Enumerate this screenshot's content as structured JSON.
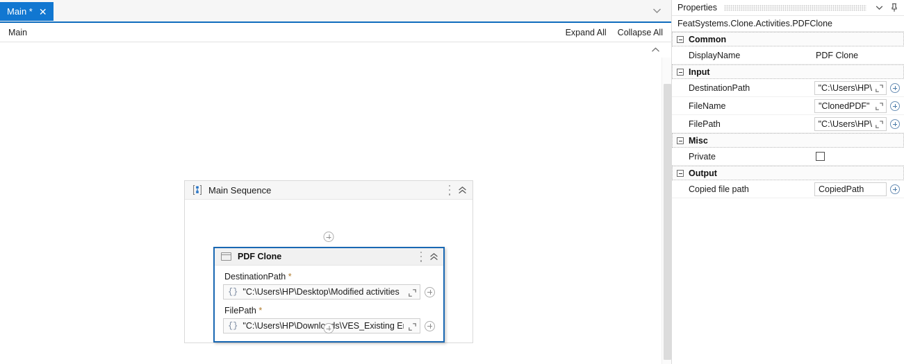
{
  "tabstrip": {
    "tab_label": "Main *",
    "close_icon": "close-icon",
    "dropdown_icon": "chevron-down-icon"
  },
  "breadcrumb": {
    "crumb": "Main",
    "expand_all": "Expand All",
    "collapse_all": "Collapse All"
  },
  "canvas": {
    "sequence": {
      "title": "Main Sequence",
      "icon": "sequence-icon",
      "menu_icon": "kebab-menu-icon",
      "collapse_icon": "double-chevron-up-icon",
      "add_above_icon": "plus-circle-icon",
      "add_below_icon": "plus-circle-icon"
    },
    "activity": {
      "title": "PDF Clone",
      "icon": "window-rect-icon",
      "menu_icon": "kebab-menu-icon",
      "collapse_icon": "double-chevron-up-icon",
      "fields": [
        {
          "label": "DestinationPath",
          "required_marker": "*",
          "prefix": "{}",
          "value": "\"C:\\Users\\HP\\Desktop\\Modified activities",
          "expand_icon": "open-expression-editor-icon",
          "plus_icon": "plus-circle-icon"
        },
        {
          "label": "FilePath",
          "required_marker": "*",
          "prefix": "{}",
          "value": "\"C:\\Users\\HP\\Downloads\\VES_Existing En",
          "expand_icon": "open-expression-editor-icon",
          "plus_icon": "plus-circle-icon"
        }
      ]
    }
  },
  "properties": {
    "panel_title": "Properties",
    "collapse_icon": "chevron-down-icon",
    "pin_icon": "pin-icon",
    "type_name": "FeatSystems.Clone.Activities.PDFClone",
    "groups": [
      {
        "name": "Common",
        "rows": [
          {
            "name": "DisplayName",
            "value": "PDF Clone",
            "kind": "text"
          }
        ]
      },
      {
        "name": "Input",
        "rows": [
          {
            "name": "DestinationPath",
            "value": "\"C:\\Users\\HP\\",
            "kind": "box",
            "expand_icon": "open-expression-editor-icon",
            "plus_icon": "plus-circle-icon"
          },
          {
            "name": "FileName",
            "value": "\"ClonedPDF\"",
            "kind": "box",
            "expand_icon": "open-expression-editor-icon",
            "plus_icon": "plus-circle-icon"
          },
          {
            "name": "FilePath",
            "value": "\"C:\\Users\\HP\\",
            "kind": "box",
            "expand_icon": "open-expression-editor-icon",
            "plus_icon": "plus-circle-icon"
          }
        ]
      },
      {
        "name": "Misc",
        "rows": [
          {
            "name": "Private",
            "value": "",
            "kind": "checkbox",
            "checked": false
          }
        ]
      },
      {
        "name": "Output",
        "rows": [
          {
            "name": "Copied file path",
            "value": "CopiedPath",
            "kind": "box-noexpand",
            "plus_icon": "plus-circle-icon"
          }
        ]
      }
    ]
  },
  "colors": {
    "tab_active": "#1177d1",
    "tab_underline": "#0f6cbd",
    "card_selected_border": "#1968b3",
    "sequence_icon": "#1f6fc4"
  }
}
